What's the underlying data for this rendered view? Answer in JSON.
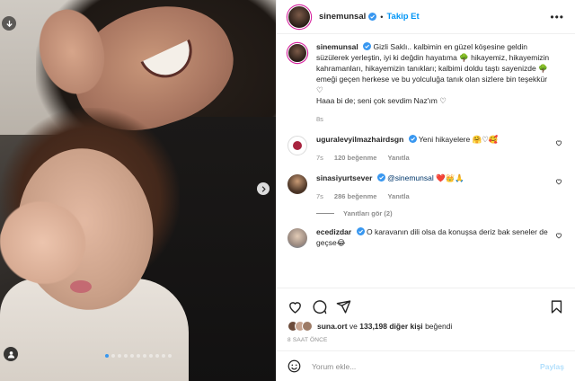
{
  "post": {
    "username": "sinemunsal",
    "follow_label": "Takip Et",
    "more_label": "•••",
    "caption": "Gizli Saklı.. kalbimin en güzel köşesine geldin süzülerek yerleştin, iyi ki değdin hayatıma 🌳 hikayemiz, hikayemizin kahramanları, hikayemizin tanıkları; kalbimi doldu taştı sayenizde 🌳 emeği geçen herkese ve bu yolculuğa tanık olan sizlere bin teşekkür ♡",
    "caption_line2": "Haaa bi de; seni çok sevdim Naz'ım ♡",
    "caption_time": "8s"
  },
  "comments": [
    {
      "username": "uguralevyilmazhairdsgn",
      "text": "Yeni hikayelere 🤗♡🥰",
      "time": "7s",
      "likes": "120 beğenme",
      "reply": "Yanıtla"
    },
    {
      "username": "sinasiyurtsever",
      "mention": "@sinemunsal",
      "text": "❤️👑🙏",
      "time": "7s",
      "likes": "286 beğenme",
      "reply": "Yanıtla",
      "view_replies": "Yanıtları gör (2)"
    },
    {
      "username": "ecedizdar",
      "text": "O karavanın dili olsa da konuşsa deriz bak seneler de geçse😂"
    }
  ],
  "likes": {
    "liker": "suna.ort",
    "connector": "ve",
    "count_text": "133,198 diğer kişi",
    "suffix": "beğendi"
  },
  "time_ago": "8 SAAT ÖNCE",
  "comment_box": {
    "placeholder": "Yorum ekle...",
    "post_label": "Paylaş"
  },
  "carousel": {
    "slides": 11,
    "active_index": 0
  },
  "colors": {
    "accent": "#0095f6",
    "muted": "#8e8e8e",
    "text": "#262626"
  }
}
